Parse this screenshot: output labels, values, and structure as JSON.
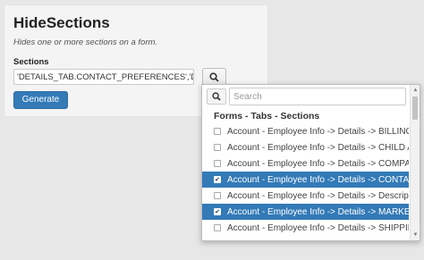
{
  "panel": {
    "title": "HideSections",
    "description": "Hides one or more sections on a form.",
    "field_label": "Sections",
    "field_value": "'DETAILS_TAB.CONTACT_PREFERENCES','DETAILS_TAB.MARKETING'",
    "generate_label": "Generate",
    "lookup_icon": "search-icon"
  },
  "dropdown": {
    "search_placeholder": "Search",
    "search_icon": "search-icon",
    "group_header": "Forms - Tabs - Sections",
    "items": [
      {
        "label": "Account - Employee Info -> Details -> BILLING",
        "checked": false
      },
      {
        "label": "Account - Employee Info -> Details -> CHILD A",
        "checked": false
      },
      {
        "label": "Account - Employee Info -> Details -> COMPA",
        "checked": false
      },
      {
        "label": "Account - Employee Info -> Details -> CONTACT",
        "checked": true
      },
      {
        "label": "Account - Employee Info -> Details -> Descript",
        "checked": false
      },
      {
        "label": "Account - Employee Info -> Details -> MARKET",
        "checked": true
      },
      {
        "label": "Account - Employee Info -> Details -> SHIPPIN",
        "checked": false
      }
    ]
  },
  "colors": {
    "accent": "#337ab7",
    "background": "#e7e7e7"
  }
}
